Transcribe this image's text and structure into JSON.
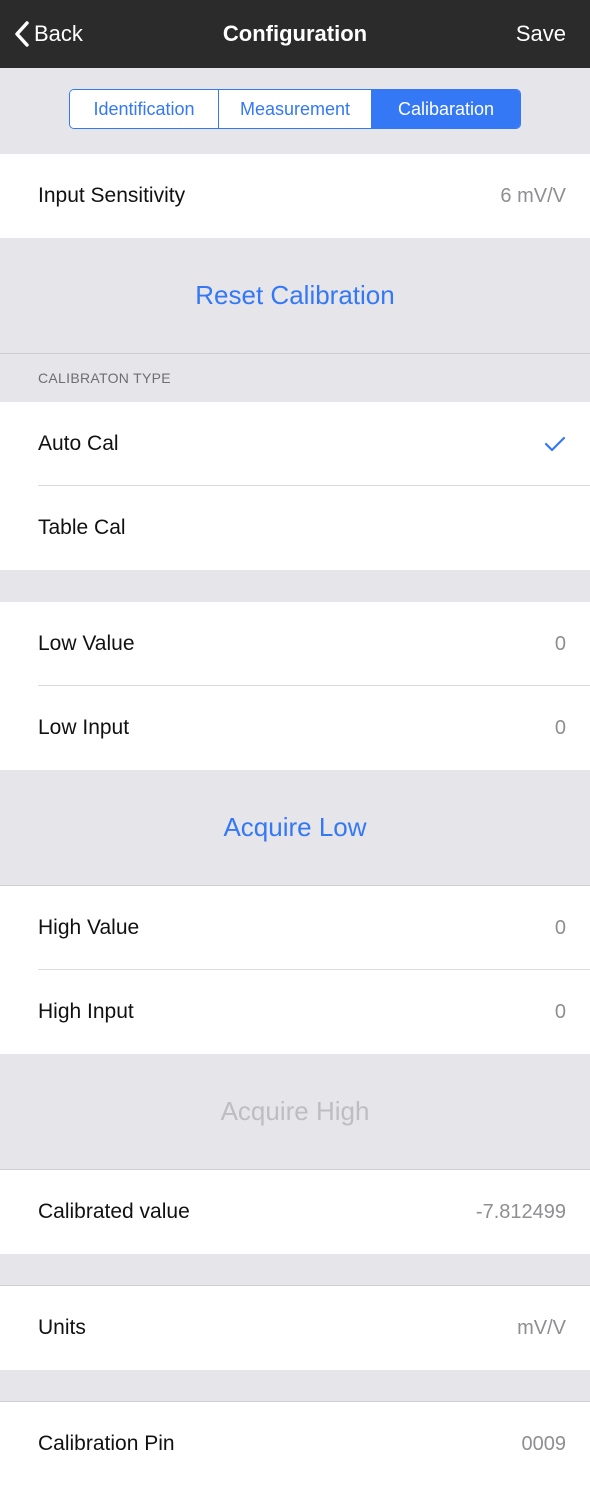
{
  "nav": {
    "back_label": "Back",
    "title": "Configuration",
    "save_label": "Save"
  },
  "segments": {
    "items": [
      "Identification",
      "Measurement",
      "Calibaration"
    ],
    "selected": "Calibaration"
  },
  "input_sensitivity": {
    "label": "Input Sensitivity",
    "value": "6 mV/V"
  },
  "reset_calibration": "Reset Calibration",
  "calibration_type": {
    "header": "CALIBRATON TYPE",
    "options": [
      {
        "label": "Auto Cal",
        "selected": true
      },
      {
        "label": "Table Cal",
        "selected": false
      }
    ]
  },
  "low": {
    "value_label": "Low Value",
    "value": "0",
    "input_label": "Low Input",
    "input": "0",
    "acquire": "Acquire Low"
  },
  "high": {
    "value_label": "High Value",
    "value": "0",
    "input_label": "High Input",
    "input": "0",
    "acquire": "Acquire High"
  },
  "calibrated": {
    "label": "Calibrated value",
    "value": "-7.812499"
  },
  "units": {
    "label": "Units",
    "value": "mV/V"
  },
  "pin": {
    "label": "Calibration Pin",
    "value": "0009"
  },
  "colors": {
    "accent": "#3478f6",
    "navbar": "#2b2b2b",
    "background": "#e5e5ea",
    "disabled": "#bdbdc2"
  }
}
